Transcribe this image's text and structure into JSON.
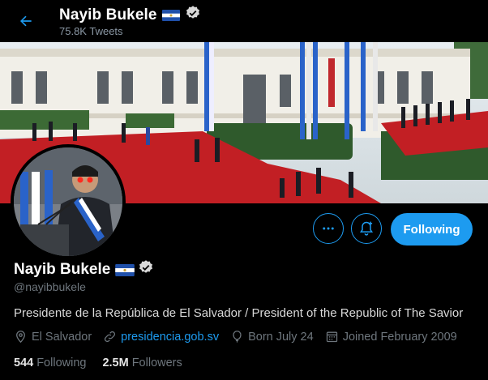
{
  "header": {
    "name": "Nayib Bukele",
    "tweet_count": "75.8K Tweets"
  },
  "profile": {
    "name": "Nayib Bukele",
    "handle": "@nayibbukele",
    "bio": "Presidente de la República de El Salvador / President of the Republic of The Savior",
    "location": "El Salvador",
    "website": "presidencia.gob.sv",
    "birthday": "Born July 24",
    "joined": "Joined February 2009",
    "following_count": "544",
    "following_label": "Following",
    "followers_count": "2.5M",
    "followers_label": "Followers"
  },
  "actions": {
    "follow_label": "Following"
  },
  "colors": {
    "accent": "#1d9bf0",
    "background": "#000000",
    "muted_text": "#6e767d",
    "flag_blue": "#1f4fa8",
    "verified": "#d9d9d9"
  },
  "icons": {
    "back": "arrow-left-icon",
    "more": "more-dots-icon",
    "notify": "bell-plus-icon",
    "location": "location-pin-icon",
    "link": "link-icon",
    "birthday": "balloon-icon",
    "calendar": "calendar-icon",
    "verified": "verified-badge-icon",
    "flag": "el-salvador-flag-icon"
  }
}
